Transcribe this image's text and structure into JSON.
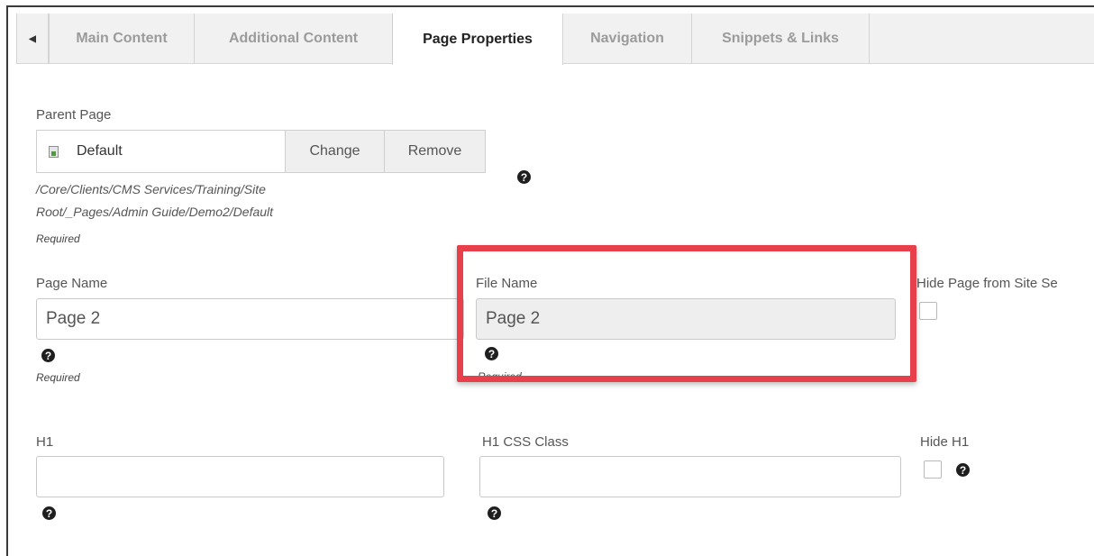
{
  "tabs": [
    {
      "label": "Main Content",
      "active": false
    },
    {
      "label": "Additional Content",
      "active": false
    },
    {
      "label": "Page Properties",
      "active": true
    },
    {
      "label": "Navigation",
      "active": false
    },
    {
      "label": "Snippets & Links",
      "active": false
    }
  ],
  "tab_scroll_icon": "caret-left-icon",
  "parent_page": {
    "label": "Parent Page",
    "value": "Default",
    "change_label": "Change",
    "remove_label": "Remove",
    "path_line1": "/Core/Clients/CMS Services/Training/Site",
    "path_line2": "Root/_Pages/Admin Guide/Demo2/Default",
    "required": "Required"
  },
  "page_name": {
    "label": "Page Name",
    "value": "Page 2",
    "required": "Required"
  },
  "file_name": {
    "label": "File Name",
    "value": "Page 2",
    "required": "Required"
  },
  "hide_search": {
    "label": "Hide Page from Site Se"
  },
  "h1": {
    "label": "H1",
    "value": ""
  },
  "h1_css_class": {
    "label": "H1 CSS Class",
    "value": ""
  },
  "hide_h1": {
    "label": "Hide H1"
  },
  "help_glyph": "?",
  "colors": {
    "highlight": "#e8404a",
    "tab_bar": "#f1f1f1"
  }
}
